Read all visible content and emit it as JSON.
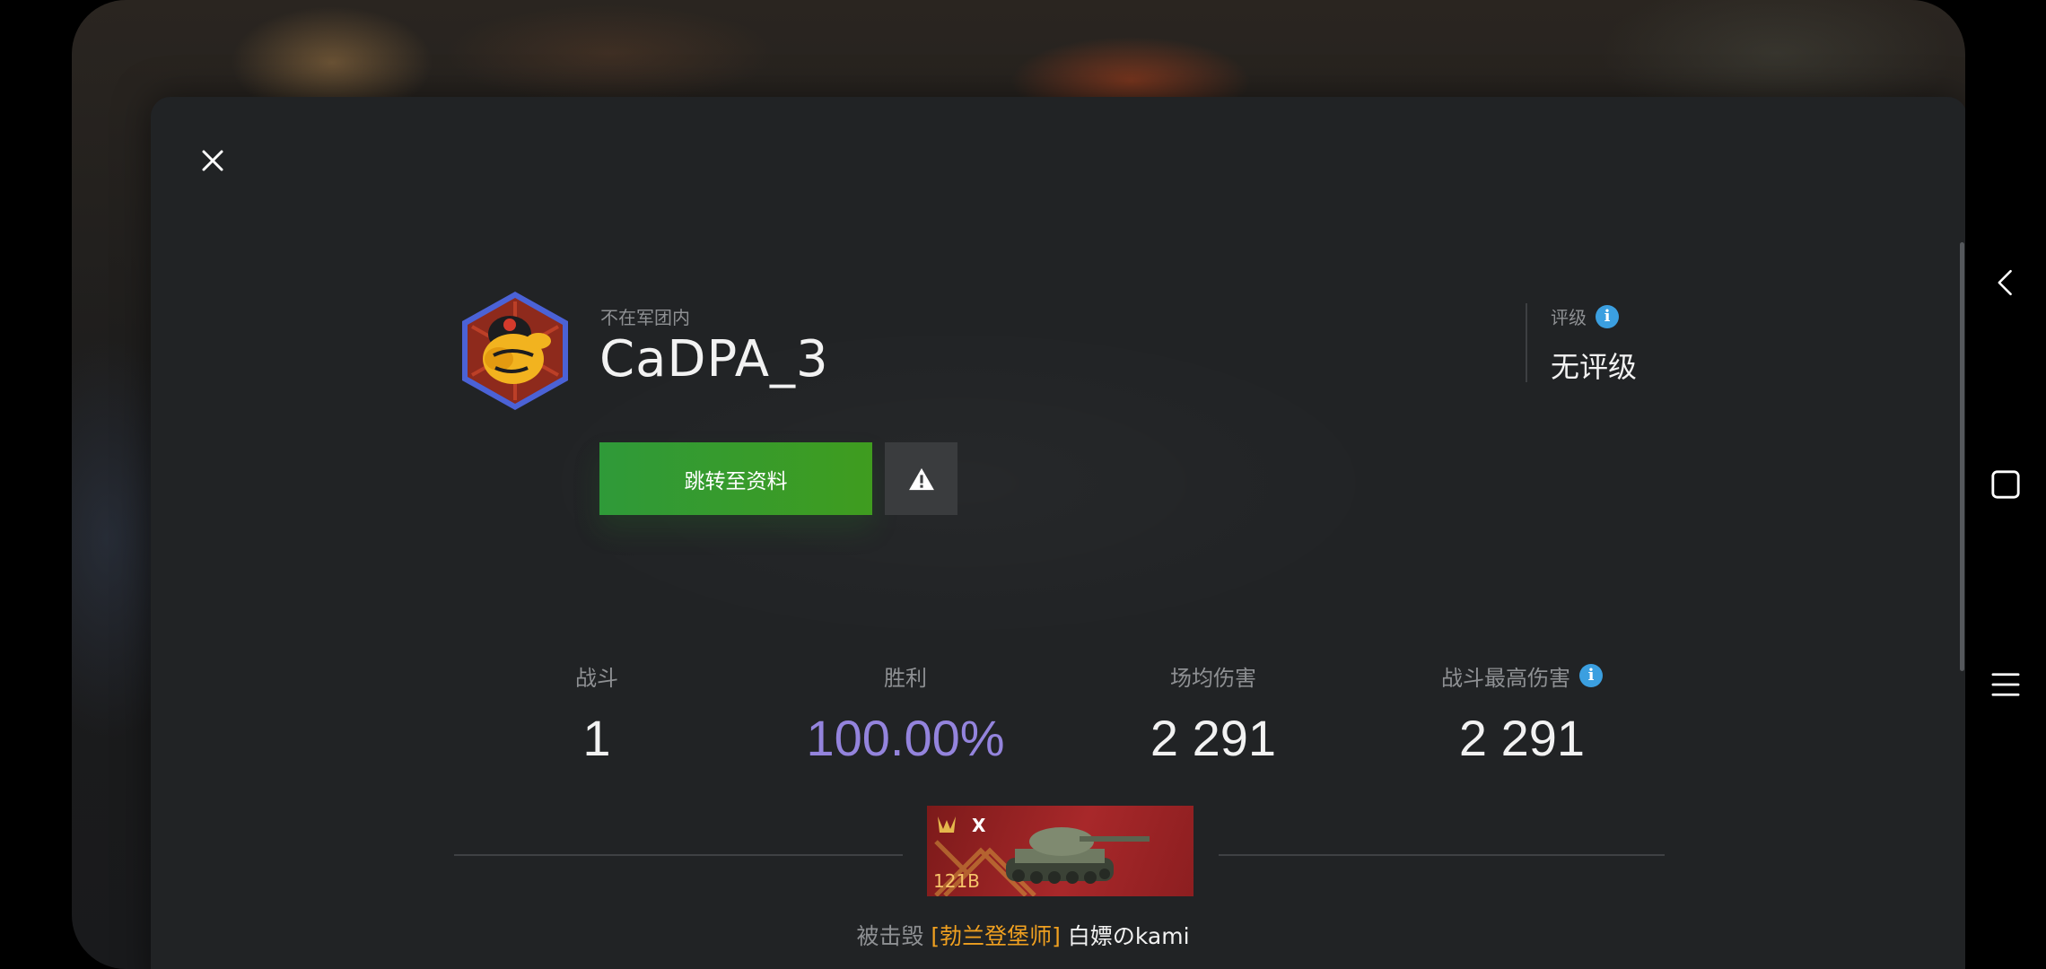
{
  "header": {
    "close_icon": "close-icon"
  },
  "player": {
    "clan_status": "不在军团内",
    "name": "CaDPA_3",
    "avatar_icon": "player-avatar-emblem"
  },
  "actions": {
    "profile_button": "跳转至资料",
    "report_icon": "warning-icon"
  },
  "rating": {
    "label": "评级",
    "info_icon": "info-icon",
    "value": "无评级"
  },
  "stats": [
    {
      "label": "战斗",
      "value": "1"
    },
    {
      "label": "胜利",
      "value": "100.00%"
    },
    {
      "label": "场均伤害",
      "value": "2 291"
    },
    {
      "label": "战斗最高伤害",
      "value": "2 291"
    }
  ],
  "tank": {
    "tier": "X",
    "name": "121B",
    "card_color": "#a8282a"
  },
  "destroyed_by": {
    "prefix": "被击毁",
    "clan_tag": "[勃兰登堡师]",
    "killer": "白嫖のkami"
  },
  "colors": {
    "accent_green": "#2f9a39",
    "win_rate": "#9484dd",
    "info_blue": "#3b9fe0",
    "clan_orange": "#f0a020"
  },
  "nav": {
    "back_icon": "back-icon",
    "home_icon": "home-icon",
    "menu_icon": "menu-icon"
  }
}
